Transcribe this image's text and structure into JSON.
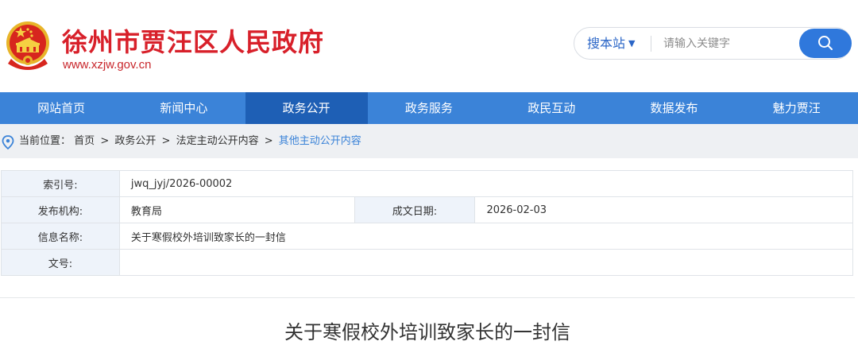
{
  "header": {
    "site_title": "徐州市贾汪区人民政府",
    "site_url": "www.xzjw.gov.cn",
    "emblem_icon": "national-emblem-icon",
    "title_color": "#d8202a"
  },
  "search": {
    "scope_label": "搜本站",
    "placeholder": "请输入关键字",
    "value": "",
    "button_icon": "search-icon",
    "accent_color": "#2f78dc"
  },
  "nav": {
    "items": [
      {
        "label": "网站首页"
      },
      {
        "label": "新闻中心"
      },
      {
        "label": "政务公开"
      },
      {
        "label": "政务服务"
      },
      {
        "label": "政民互动"
      },
      {
        "label": "数据发布"
      },
      {
        "label": "魅力贾汪"
      }
    ],
    "active_index": 2,
    "bar_color": "#3b83d8",
    "active_color": "#1e5fb5"
  },
  "breadcrumb": {
    "prefix": "当前位置：",
    "items": [
      "首页",
      "政务公开",
      "法定主动公开内容",
      "其他主动公开内容"
    ],
    "separator": ">",
    "icon": "location-pin-icon"
  },
  "info": {
    "index_label": "索引号:",
    "index_value": "jwq_jyj/2026-00002",
    "publisher_label": "发布机构:",
    "publisher_value": "教育局",
    "date_label": "成文日期:",
    "date_value": "2026-02-03",
    "name_label": "信息名称:",
    "name_value": "关于寒假校外培训致家长的一封信",
    "doc_no_label": "文号:",
    "doc_no_value": ""
  },
  "article": {
    "title": "关于寒假校外培训致家长的一封信"
  }
}
